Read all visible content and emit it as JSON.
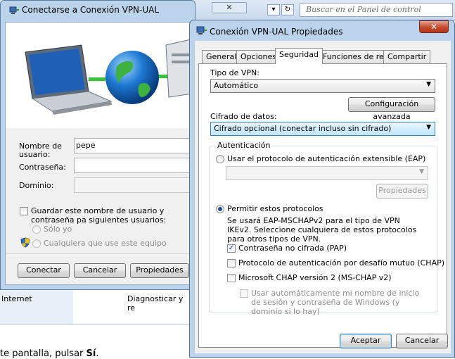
{
  "background": {
    "search_placeholder": "Buscar en el Panel de control",
    "nav_dropdown": "▾",
    "nav_refresh": "↻",
    "strip_left": "Internet",
    "strip_right": "Diagnosticar y re",
    "bottom_text_prefix": "te pantalla, pulsar ",
    "bottom_text_bold": "Sí",
    "bottom_text_suffix": "."
  },
  "connect_dialog": {
    "title": "Conectarse a Conexión VPN-UAL",
    "close": "✕",
    "username_label": "Nombre de usuario:",
    "username_value": "pepe",
    "password_label": "Contraseña:",
    "domain_label": "Dominio:",
    "save_label": "Guardar este nombre de usuario y contraseña pa siguientes usuarios:",
    "only_me": "Sólo yo",
    "anyone": "Cualquiera que use este equipo",
    "connect": "Conectar",
    "cancel": "Cancelar",
    "properties": "Propiedades"
  },
  "props_dialog": {
    "title": "Conexión VPN-UAL Propiedades",
    "close": "✕",
    "tabs": [
      "General",
      "Opciones",
      "Seguridad",
      "Funciones de red",
      "Compartir"
    ],
    "vpn_type_label": "Tipo de VPN:",
    "vpn_type_value": "Automático",
    "advanced_config": "Configuración avanzada",
    "encryption_label": "Cifrado de datos:",
    "encryption_value": "Cifrado opcional (conectar incluso sin cifrado)",
    "auth_group": "Autenticación",
    "eap_option": "Usar el protocolo de autenticación extensible (EAP)",
    "eap_properties": "Propiedades",
    "allow_protocols": "Permitir estos protocolos",
    "protocols_note": "Se usará EAP-MSCHAPv2 para el tipo de VPN IKEv2. Seleccione cualquiera de estos protocolos para otros tipos de VPN.",
    "pap": "Contraseña no cifrada (PAP)",
    "chap": "Protocolo de autenticación por desafío mutuo (CHAP)",
    "mschap": "Microsoft CHAP versión 2 (MS-CHAP v2)",
    "auto_logon": "Usar automáticamente mi nombre de inicio de sesión y contraseña de Windows (y dominio si lo hay)",
    "checkmark": "✓",
    "dropdown_arrow": "▼",
    "ok": "Aceptar",
    "cancel": "Cancelar"
  },
  "colors": {
    "title_bar": "#bcd3ec",
    "close_red": "#c54a2c",
    "accent": "#3c7fb1"
  }
}
